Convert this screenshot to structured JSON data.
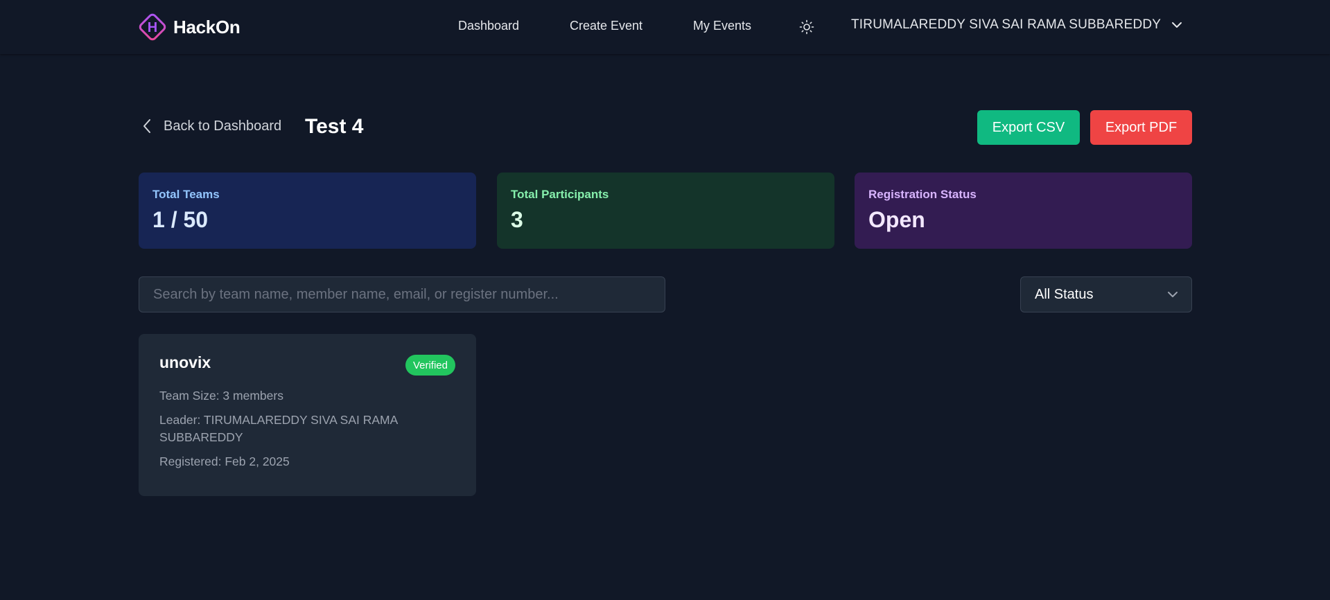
{
  "brand": {
    "logo_letter": "H",
    "name": "HackOn"
  },
  "nav": {
    "dashboard": "Dashboard",
    "create_event": "Create Event",
    "my_events": "My Events",
    "theme_icon": "sun-icon",
    "user_name": "TIRUMALAREDDY SIVA SAI RAMA SUBBAREDDY"
  },
  "page": {
    "back_label": "Back to Dashboard",
    "title": "Test 4",
    "export_csv": "Export CSV",
    "export_pdf": "Export PDF"
  },
  "stats": {
    "total_teams": {
      "label": "Total Teams",
      "value": "1 / 50"
    },
    "total_participants": {
      "label": "Total Participants",
      "value": "3"
    },
    "registration_status": {
      "label": "Registration Status",
      "value": "Open"
    }
  },
  "filters": {
    "search_placeholder": "Search by team name, member name, email, or register number...",
    "search_value": "",
    "status_selected": "All Status"
  },
  "teams": [
    {
      "name": "unovix",
      "badge": "Verified",
      "size": "Team Size: 3 members",
      "leader": "Leader: TIRUMALAREDDY SIVA SAI RAMA SUBBAREDDY",
      "registered": "Registered: Feb 2, 2025"
    }
  ],
  "colors": {
    "background": "#111827",
    "card": "#1f2937",
    "export_csv": "#10b981",
    "export_pdf": "#ef4444",
    "verified": "#22c55e",
    "teams_card": "#172554",
    "participants_card": "#14342a",
    "status_card": "#331c52"
  }
}
